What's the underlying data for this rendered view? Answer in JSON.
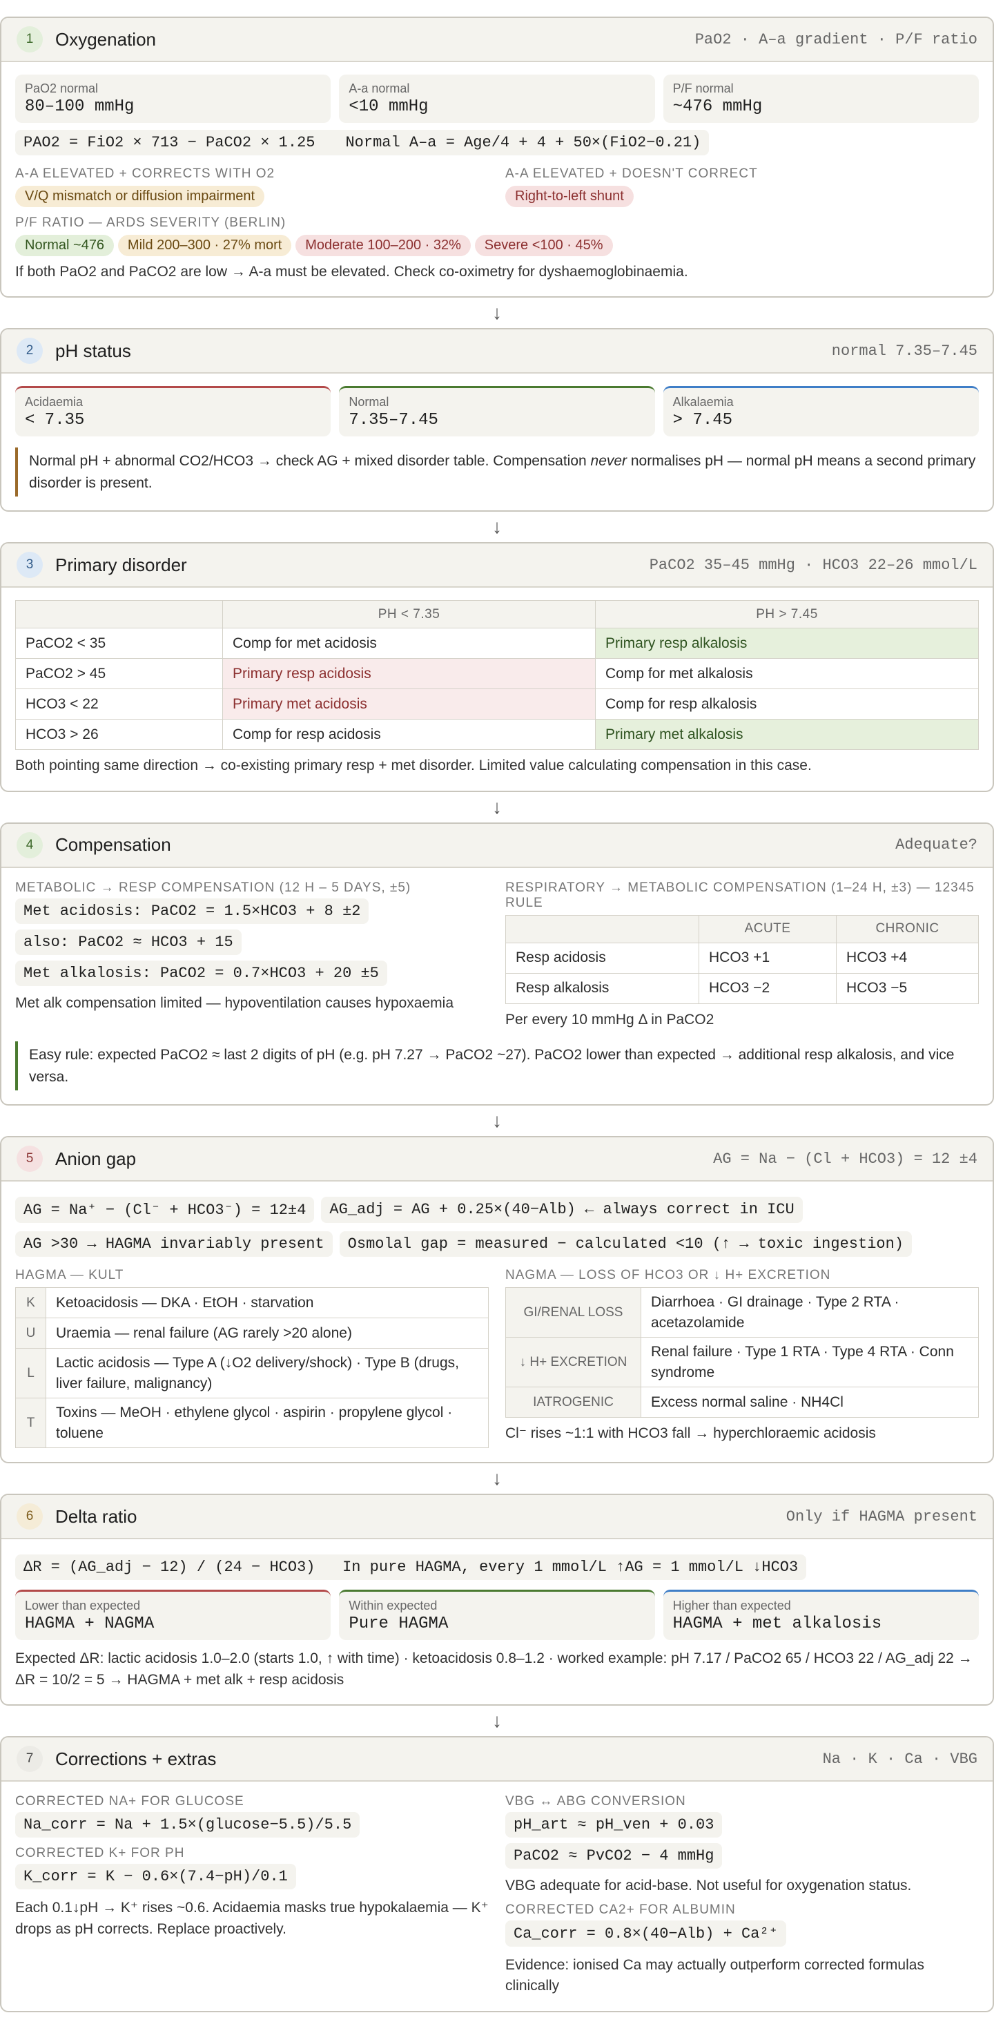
{
  "s1": {
    "num": "1",
    "title": "Oxygenation",
    "meta": "PaO2 · A–a gradient · P/F ratio",
    "stats": [
      {
        "label": "PaO2 normal",
        "value": "80–100 mmHg"
      },
      {
        "label": "A-a normal",
        "value": "<10 mmHg"
      },
      {
        "label": "P/F normal",
        "value": "~476 mmHg"
      }
    ],
    "formulas": [
      "PAO2 = FiO2 × 713 − PaCO2 × 1.25",
      "Normal A–a = Age/4 + 4 + 50×(FiO2−0.21)"
    ],
    "left_caps": "A-a elevated + corrects with O2",
    "left_pill": "V/Q mismatch or diffusion impairment",
    "right_caps": "A-a elevated + doesn't correct",
    "right_pill": "Right-to-left shunt",
    "pf_caps": "P/F ratio — ARDS severity (Berlin)",
    "pf_pills": [
      "Normal ~476",
      "Mild 200–300 · 27% mort",
      "Moderate 100–200 · 32%",
      "Severe <100 · 45%"
    ],
    "note": "If both PaO2 and PaCO2 are low → A-a must be elevated. Check co-oximetry for dyshaemoglobinaemia."
  },
  "s2": {
    "num": "2",
    "title": "pH status",
    "meta": "normal 7.35–7.45",
    "stats": [
      {
        "label": "Acidaemia",
        "value": "< 7.35"
      },
      {
        "label": "Normal",
        "value": "7.35–7.45"
      },
      {
        "label": "Alkalaemia",
        "value": "> 7.45"
      }
    ],
    "callout_a": "Normal pH + abnormal CO2/HCO3 → check AG + mixed disorder table. Compensation ",
    "callout_em": "never",
    "callout_b": " normalises pH — normal pH means a second primary disorder is present."
  },
  "s3": {
    "num": "3",
    "title": "Primary disorder",
    "meta": "PaCO2 35–45 mmHg · HCO3 22–26 mmol/L",
    "headers": [
      "",
      "pH < 7.35",
      "pH > 7.45"
    ],
    "rows": [
      [
        "PaCO2 < 35",
        "Comp for met acidosis",
        "Primary resp alkalosis"
      ],
      [
        "PaCO2 > 45",
        "Primary resp acidosis",
        "Comp for met alkalosis"
      ],
      [
        "HCO3 < 22",
        "Primary met acidosis",
        "Comp for resp alkalosis"
      ],
      [
        "HCO3 > 26",
        "Comp for resp acidosis",
        "Primary met alkalosis"
      ]
    ],
    "note": "Both pointing same direction → co-existing primary resp + met disorder. Limited value calculating compensation in this case."
  },
  "s4": {
    "num": "4",
    "title": "Compensation",
    "meta": "Adequate?",
    "left_caps": "Metabolic → resp compensation (12 h – 5 days, ±5)",
    "formulas": [
      "Met acidosis: PaCO2 = 1.5×HCO3 + 8 ±2",
      "also: PaCO2 ≈ HCO3 + 15",
      "Met alkalosis: PaCO2 = 0.7×HCO3 + 20 ±5"
    ],
    "left_note": "Met alk compensation limited — hypoventilation causes hypoxaemia",
    "right_caps": "Respiratory → metabolic compensation (1–24 h, ±3) — 12345 rule",
    "headers": [
      "",
      "Acute",
      "Chronic"
    ],
    "rows": [
      [
        "Resp acidosis",
        "HCO3 +1",
        "HCO3 +4"
      ],
      [
        "Resp alkalosis",
        "HCO3 −2",
        "HCO3 −5"
      ]
    ],
    "right_note": "Per every 10 mmHg Δ in PaCO2",
    "callout": "Easy rule: expected PaCO2 ≈ last 2 digits of pH (e.g. pH 7.27 → PaCO2 ~27). PaCO2 lower than expected → additional resp alkalosis, and vice versa."
  },
  "s5": {
    "num": "5",
    "title": "Anion gap",
    "meta": "AG = Na − (Cl + HCO3) = 12 ±4",
    "formulas": [
      "AG = Na⁺ − (Cl⁻ + HCO3⁻) = 12±4",
      "AG_adj = AG + 0.25×(40−Alb) ← always correct in ICU",
      "AG >30 → HAGMA invariably present",
      "Osmolal gap = measured − calculated <10 (↑ → toxic ingestion)"
    ],
    "left_caps": "HAGMA — KULT",
    "kult": [
      [
        "K",
        "Ketoacidosis — DKA · EtOH · starvation"
      ],
      [
        "U",
        "Uraemia — renal failure (AG rarely >20 alone)"
      ],
      [
        "L",
        "Lactic acidosis — Type A (↓O2 delivery/shock) · Type B (drugs, liver failure, malignancy)"
      ],
      [
        "T",
        "Toxins — MeOH · ethylene glycol · aspirin · propylene glycol · toluene"
      ]
    ],
    "right_caps": "NAGMA — loss of HCO3 or ↓ H+ excretion",
    "nagma": [
      [
        "GI/renal loss",
        "Diarrhoea · GI drainage · Type 2 RTA · acetazolamide"
      ],
      [
        "↓ H+ excretion",
        "Renal failure · Type 1 RTA · Type 4 RTA · Conn syndrome"
      ],
      [
        "Iatrogenic",
        "Excess normal saline · NH4Cl"
      ]
    ],
    "right_note": "Cl⁻ rises ~1:1 with HCO3 fall → hyperchloraemic acidosis"
  },
  "s6": {
    "num": "6",
    "title": "Delta ratio",
    "meta": "Only if HAGMA present",
    "formula": "ΔR = (AG_adj − 12) / (24 − HCO3)   In pure HAGMA, every 1 mmol/L ↑AG = 1 mmol/L ↓HCO3",
    "stats": [
      {
        "label": "Lower than expected",
        "value": "HAGMA + NAGMA"
      },
      {
        "label": "Within expected",
        "value": "Pure HAGMA"
      },
      {
        "label": "Higher than expected",
        "value": "HAGMA + met alkalosis"
      }
    ],
    "note": "Expected ΔR: lactic acidosis 1.0–2.0 (starts 1.0, ↑ with time) · ketoacidosis 0.8–1.2 · worked example: pH 7.17 / PaCO2 65 / HCO3 22 / AG_adj 22 → ΔR = 10/2 = 5 → HAGMA + met alk + resp acidosis"
  },
  "s7": {
    "num": "7",
    "title": "Corrections + extras",
    "meta": "Na · K · Ca · VBG",
    "na_caps": "Corrected Na+ for glucose",
    "na_formula": "Na_corr = Na + 1.5×(glucose−5.5)/5.5",
    "k_caps": "Corrected K+ for pH",
    "k_formula": "K_corr = K − 0.6×(7.4−pH)/0.1",
    "k_note": "Each 0.1↓pH → K⁺ rises ~0.6. Acidaemia masks true hypokalaemia — K⁺ drops as pH corrects. Replace proactively.",
    "vbg_caps": "VBG ↔ ABG conversion",
    "vbg_formulas": [
      "pH_art ≈ pH_ven + 0.03",
      "PaCO2 ≈ PvCO2 − 4 mmHg"
    ],
    "vbg_note": "VBG adequate for acid-base. Not useful for oxygenation status.",
    "ca_caps": "Corrected Ca2+ for albumin",
    "ca_formula": "Ca_corr = 0.8×(40−Alb) + Ca²⁺",
    "ca_note": "Evidence: ionised Ca may actually outperform corrected formulas clinically"
  },
  "arrow_glyph": "↓"
}
